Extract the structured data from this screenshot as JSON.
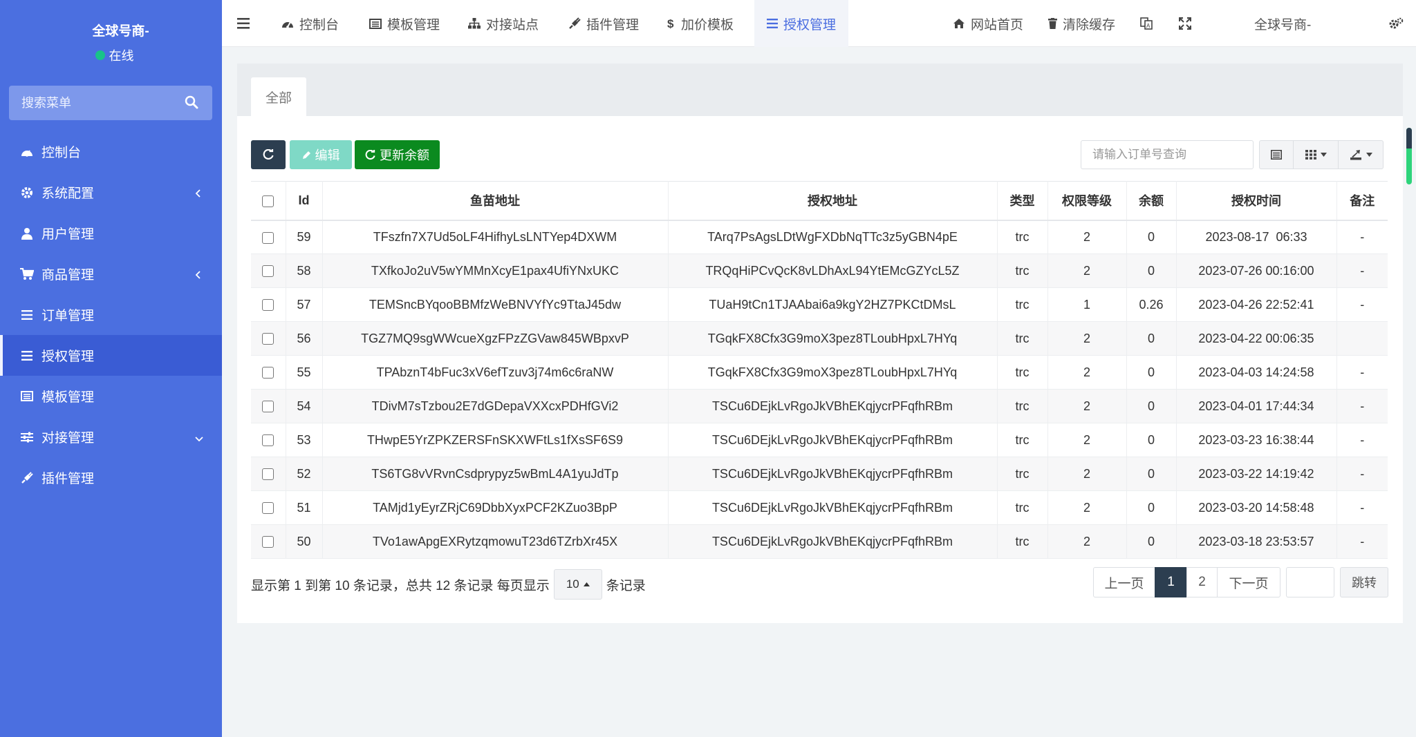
{
  "sidebar": {
    "user_name": "全球号商-",
    "user_status": "在线",
    "search_placeholder": "搜索菜单",
    "items": [
      {
        "label": "控制台",
        "icon": "dashboard-icon",
        "has_chevron": false
      },
      {
        "label": "系统配置",
        "icon": "gear-icon",
        "has_chevron": true
      },
      {
        "label": "用户管理",
        "icon": "user-icon",
        "has_chevron": false
      },
      {
        "label": "商品管理",
        "icon": "cart-icon",
        "has_chevron": true
      },
      {
        "label": "订单管理",
        "icon": "list-icon",
        "has_chevron": false
      },
      {
        "label": "授权管理",
        "icon": "list-icon",
        "has_chevron": false,
        "active": true
      },
      {
        "label": "模板管理",
        "icon": "template-icon",
        "has_chevron": false
      },
      {
        "label": "对接管理",
        "icon": "sliders-icon",
        "has_chevron": true
      },
      {
        "label": "插件管理",
        "icon": "plug-icon",
        "has_chevron": false
      }
    ]
  },
  "topbar": {
    "nav": [
      {
        "label": "控制台",
        "icon": "dashboard-icon"
      },
      {
        "label": "模板管理",
        "icon": "template-icon"
      },
      {
        "label": "对接站点",
        "icon": "sitemap-icon"
      },
      {
        "label": "插件管理",
        "icon": "plug-icon"
      },
      {
        "label": "加价模板",
        "icon": "dollar-icon"
      },
      {
        "label": "授权管理",
        "icon": "list-icon",
        "active": true
      }
    ],
    "home_label": "网站首页",
    "clear_cache_label": "清除缓存",
    "user_label": "全球号商-"
  },
  "tabs": {
    "all_label": "全部"
  },
  "toolbar": {
    "edit_label": "编辑",
    "update_balance_label": "更新余额",
    "search_placeholder": "请输入订单号查询"
  },
  "table": {
    "headers": [
      "Id",
      "鱼苗地址",
      "授权地址",
      "类型",
      "权限等级",
      "余额",
      "授权时间",
      "备注"
    ],
    "rows": [
      {
        "id": "59",
        "fish": "TFszfn7X7Ud5oLF4HifhyLsLNTYep4DXWM",
        "auth": "TArq7PsAgsLDtWgFXDbNqTTc3z5yGBN4pE",
        "type": "trc",
        "level": "2",
        "balance": "0",
        "time": "2023-08-17 ⁠  06:33",
        "note": "-"
      },
      {
        "id": "58",
        "fish": "TXfkoJo2uV5wYMMnXcyE1pax4UfiYNxUKC",
        "auth": "TRQqHiPCvQcK8vLDhAxL94YtEMcGZYcL5Z",
        "type": "trc",
        "level": "2",
        "balance": "0",
        "time": "2023-07-26 00:16:00",
        "note": "-"
      },
      {
        "id": "57",
        "fish": "TEMSncBYqooBBMfzWeBNVYfYc9TtaJ45dw",
        "auth": "TUaH9tCn1TJAAbai6a9kgY2HZ7PKCtDMsL",
        "type": "trc",
        "level": "1",
        "balance": "0.26",
        "time": "2023-04-26 22:52:41",
        "note": "-"
      },
      {
        "id": "56",
        "fish": "TGZ7MQ9sgWWcueXgzFPzZGVaw845WBpxvP",
        "auth": "TGqkFX8Cfx3G9moX3pez8TLoubHpxL7HYq",
        "type": "trc",
        "level": "2",
        "balance": "0",
        "time": "2023-04-22 00:06:35",
        "note": ""
      },
      {
        "id": "55",
        "fish": "TPAbznT4bFuc3xV6efTzuv3j74m6c6raNW",
        "auth": "TGqkFX8Cfx3G9moX3pez8TLoubHpxL7HYq",
        "type": "trc",
        "level": "2",
        "balance": "0",
        "time": "2023-04-03 14:24:58",
        "note": "-"
      },
      {
        "id": "54",
        "fish": "TDivM7sTzbou2E7dGDepaVXXcxPDHfGVi2",
        "auth": "TSCu6DEjkLvRgoJkVBhEKqjycrPFqfhRBm",
        "type": "trc",
        "level": "2",
        "balance": "0",
        "time": "2023-04-01 17:44:34",
        "note": "-"
      },
      {
        "id": "53",
        "fish": "THwpE5YrZPKZERSFnSKXWFtLs1fXsSF6S9",
        "auth": "TSCu6DEjkLvRgoJkVBhEKqjycrPFqfhRBm",
        "type": "trc",
        "level": "2",
        "balance": "0",
        "time": "2023-03-23 16:38:44",
        "note": "-"
      },
      {
        "id": "52",
        "fish": "TS6TG8vVRvnCsdprypyz5wBmL4A1yuJdTp",
        "auth": "TSCu6DEjkLvRgoJkVBhEKqjycrPFqfhRBm",
        "type": "trc",
        "level": "2",
        "balance": "0",
        "time": "2023-03-22 14:19:42",
        "note": "-"
      },
      {
        "id": "51",
        "fish": "TAMjd1yEyrZRjC69DbbXyxPCF2KZuo3BpP",
        "auth": "TSCu6DEjkLvRgoJkVBhEKqjycrPFqfhRBm",
        "type": "trc",
        "level": "2",
        "balance": "0",
        "time": "2023-03-20 14:58:48",
        "note": "-"
      },
      {
        "id": "50",
        "fish": "TVo1awApgEXRytzqmowuT23d6TZrbXr45X",
        "auth": "TSCu6DEjkLvRgoJkVBhEKqjycrPFqfhRBm",
        "type": "trc",
        "level": "2",
        "balance": "0",
        "time": "2023-03-18 23:53:57",
        "note": "-"
      }
    ]
  },
  "pagination": {
    "info_prefix": "显示第 1 到第 10 条记录，总共 12 条记录 每页显示",
    "page_size": "10",
    "info_suffix": "条记录",
    "prev_label": "上一页",
    "pages": [
      "1",
      "2"
    ],
    "current_page": "1",
    "next_label": "下一页",
    "jump_label": "跳转"
  },
  "colors": {
    "sidebar_bg": "#4b6fe0",
    "accent": "#4a6de0",
    "dark_button": "#2c3e50",
    "success_button": "#0b8a1f",
    "edit_button": "#7fd9c6",
    "online_dot": "#18c389"
  }
}
